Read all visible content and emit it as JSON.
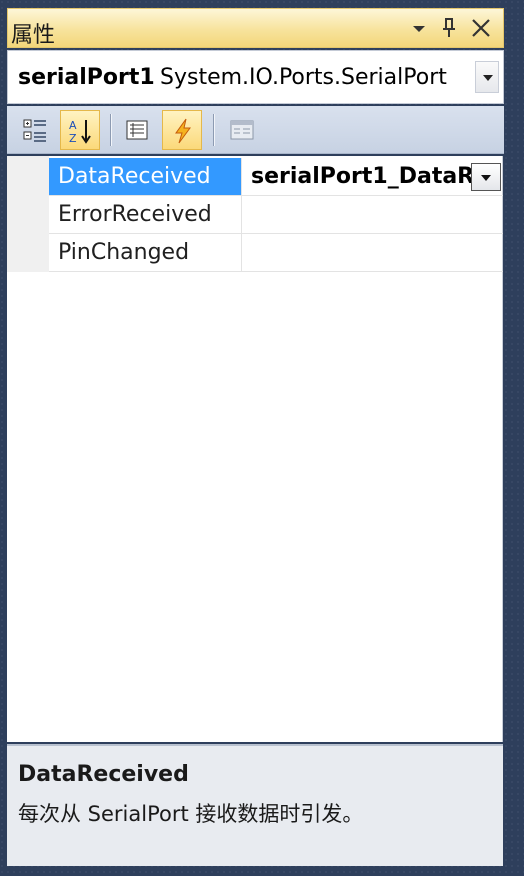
{
  "window": {
    "title": "属性",
    "dropdown_icon": "chevron-down-icon",
    "pin_icon": "pin-icon",
    "close_icon": "close-icon"
  },
  "object_selector": {
    "name": "serialPort1",
    "type": "System.IO.Ports.SerialPort"
  },
  "toolbar": {
    "buttons": [
      {
        "icon": "categorized-icon",
        "active": false
      },
      {
        "icon": "alphabetical-sort-icon",
        "active": true
      },
      {
        "icon": "properties-icon",
        "active": false
      },
      {
        "icon": "events-lightning-icon",
        "active": true
      },
      {
        "icon": "property-pages-icon",
        "active": false
      }
    ]
  },
  "events": [
    {
      "name": "DataReceived",
      "value": "serialPort1_DataR",
      "selected": true
    },
    {
      "name": "ErrorReceived",
      "value": "",
      "selected": false
    },
    {
      "name": "PinChanged",
      "value": "",
      "selected": false
    }
  ],
  "description": {
    "title": "DataReceived",
    "text": "每次从 SerialPort 接收数据时引发。"
  },
  "colors": {
    "title_bar": "#f7e39c",
    "selection": "#3399ff",
    "frame": "#2e3f5c"
  }
}
